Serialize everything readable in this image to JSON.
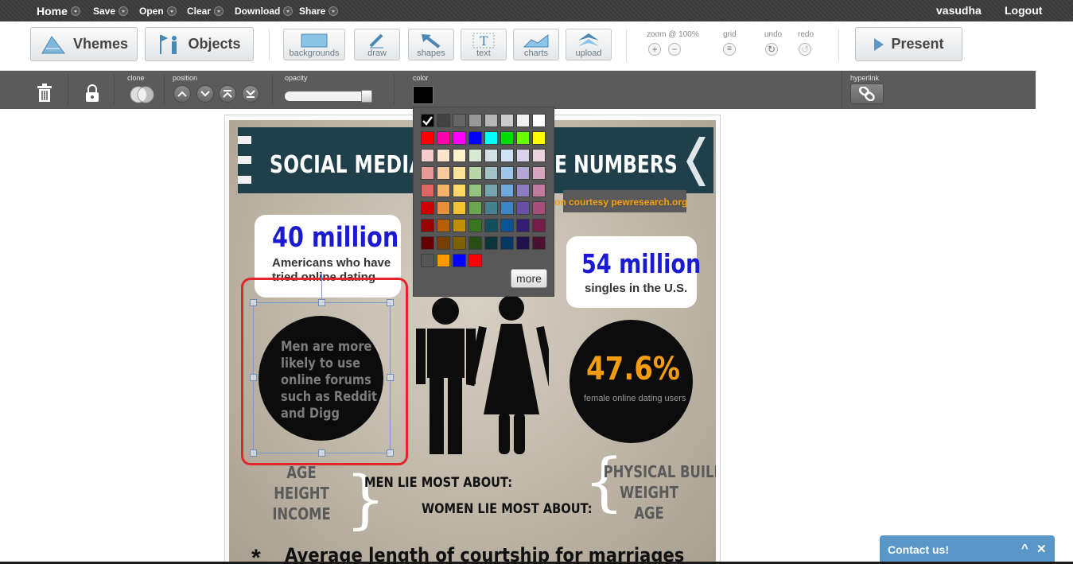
{
  "topbar": {
    "menus": [
      "Home",
      "Save",
      "Open",
      "Clear",
      "Download",
      "Share"
    ],
    "username": "vasudha",
    "logout": "Logout"
  },
  "toolbar": {
    "vhemes": "Vhemes",
    "objects": "Objects",
    "tools": [
      "backgrounds",
      "draw",
      "shapes",
      "text",
      "charts",
      "upload"
    ],
    "zoom_label": "zoom @ 100%",
    "grid_label": "grid",
    "undo_label": "undo",
    "redo_label": "redo",
    "present": "Present"
  },
  "propbar": {
    "clone_label": "clone",
    "position_label": "position",
    "opacity_label": "opacity",
    "opacity_value": 1.0,
    "color_label": "color",
    "color_value": "#000000",
    "hyperlink_label": "hyperlink"
  },
  "color_picker": {
    "rows": [
      [
        "#000000",
        "#434343",
        "#666666",
        "#999999",
        "#b7b7b7",
        "#cccccc",
        "#efefef",
        "#ffffff"
      ],
      [
        "#ff0000",
        "#ff00aa",
        "#ff00ff",
        "#0000ff",
        "#00ffff",
        "#00dd00",
        "#66ff00",
        "#ffff00"
      ],
      [
        "#f4cccc",
        "#fce5cd",
        "#fff2cc",
        "#d9ead3",
        "#d0e0e3",
        "#cfe2f3",
        "#d9d2e9",
        "#ead1dc"
      ],
      [
        "#ea9999",
        "#f9cb9c",
        "#ffe599",
        "#b6d7a8",
        "#a2c4c9",
        "#9fc5e8",
        "#b4a7d6",
        "#d5a6bd"
      ],
      [
        "#e06666",
        "#f6b26b",
        "#ffd966",
        "#93c47d",
        "#76a5af",
        "#6fa8dc",
        "#8e7cc3",
        "#c27ba0"
      ],
      [
        "#cc0000",
        "#e69138",
        "#f1c232",
        "#6aa84f",
        "#45818e",
        "#3d85c6",
        "#674ea7",
        "#a64d79"
      ],
      [
        "#990000",
        "#b45f06",
        "#bf9000",
        "#38761d",
        "#134f5c",
        "#0b5394",
        "#351c75",
        "#741b47"
      ],
      [
        "#660000",
        "#783f04",
        "#7f6000",
        "#274e13",
        "#0c343d",
        "#073763",
        "#20124d",
        "#4c1130"
      ],
      [
        "#555555",
        "#ff9900",
        "#0000ff",
        "#ff0000"
      ]
    ],
    "selected": "#000000",
    "more": "more"
  },
  "poster": {
    "title_left": "SOCIAL MEDIA S",
    "title_right": "E NUMBERS",
    "courtesy": "on courtesy pewresearch.org",
    "stat1_big": "40 million",
    "stat1_sub_a": "Americans who have",
    "stat1_sub_b": "tried online dating",
    "stat2_big": "54 million",
    "stat2_sub": "singles in the U.S.",
    "circle_text": [
      "Men are more",
      "likely to use",
      "online forums",
      "such as Reddit",
      "and Digg"
    ],
    "pct": "47.6%",
    "pct_sub": "female online dating users",
    "men_lie": "MEN LIE MOST ABOUT:",
    "women_lie": "WOMEN LIE MOST ABOUT:",
    "left_list": [
      "AGE",
      "HEIGHT",
      "INCOME"
    ],
    "right_list": [
      "PHYSICAL BUILD",
      "WEIGHT",
      "AGE"
    ],
    "asterisk": "*",
    "average": "Average length of courtship for marriages"
  },
  "contact": {
    "label": "Contact us!"
  }
}
